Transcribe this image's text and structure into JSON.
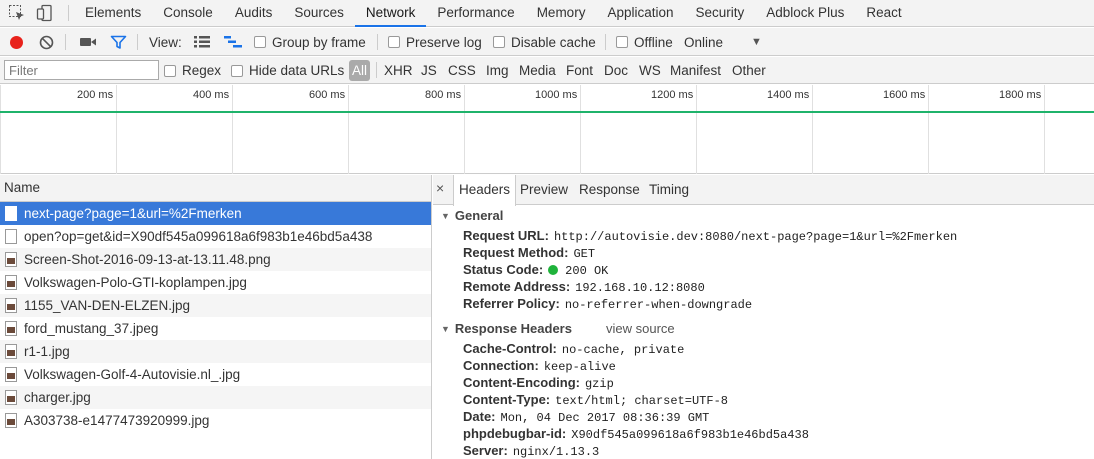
{
  "tabbar": {
    "tabs": [
      {
        "label": "Elements"
      },
      {
        "label": "Console"
      },
      {
        "label": "Audits"
      },
      {
        "label": "Sources"
      },
      {
        "label": "Network"
      },
      {
        "label": "Performance"
      },
      {
        "label": "Memory"
      },
      {
        "label": "Application"
      },
      {
        "label": "Security"
      },
      {
        "label": "Adblock Plus"
      },
      {
        "label": "React"
      }
    ],
    "active_tab": "Network"
  },
  "toolbar": {
    "view_label": "View:",
    "group_by_frame": "Group by frame",
    "preserve_log": "Preserve log",
    "disable_cache": "Disable cache",
    "offline": "Offline",
    "throttle_value": "Online",
    "dropdown_arrow": "▼"
  },
  "filter": {
    "placeholder": "Filter",
    "regex": "Regex",
    "hide_data_urls": "Hide data URLs",
    "types": [
      "All",
      "XHR",
      "JS",
      "CSS",
      "Img",
      "Media",
      "Font",
      "Doc",
      "WS",
      "Manifest",
      "Other"
    ],
    "active_type": "All"
  },
  "timeline": {
    "ticks": [
      "200 ms",
      "400 ms",
      "600 ms",
      "800 ms",
      "1000 ms",
      "1200 ms",
      "1400 ms",
      "1600 ms",
      "1800 ms"
    ]
  },
  "list": {
    "header": "Name",
    "rows": [
      {
        "name": "next-page?page=1&url=%2Fmerken",
        "icon": "doc",
        "selected": true
      },
      {
        "name": "open?op=get&id=X90df545a099618a6f983b1e46bd5a438",
        "icon": "doc"
      },
      {
        "name": "Screen-Shot-2016-09-13-at-13.11.48.png",
        "icon": "image"
      },
      {
        "name": "Volkswagen-Polo-GTI-koplampen.jpg",
        "icon": "image"
      },
      {
        "name": "1155_VAN-DEN-ELZEN.jpg",
        "icon": "image"
      },
      {
        "name": "ford_mustang_37.jpeg",
        "icon": "image"
      },
      {
        "name": "r1-1.jpg",
        "icon": "image"
      },
      {
        "name": "Volkswagen-Golf-4-Autovisie.nl_.jpg",
        "icon": "image"
      },
      {
        "name": "charger.jpg",
        "icon": "image"
      },
      {
        "name": "A303738-e1477473920999.jpg",
        "icon": "image"
      }
    ]
  },
  "details": {
    "close": "×",
    "tabs": [
      "Headers",
      "Preview",
      "Response",
      "Timing"
    ],
    "active_tab": "Headers",
    "general": {
      "title": "General",
      "items": [
        {
          "key": "Request URL:",
          "value": "http://autovisie.dev:8080/next-page?page=1&url=%2Fmerken"
        },
        {
          "key": "Request Method:",
          "value": "GET"
        },
        {
          "key": "Status Code:",
          "value": "200 OK"
        },
        {
          "key": "Remote Address:",
          "value": "192.168.10.12:8080"
        },
        {
          "key": "Referrer Policy:",
          "value": "no-referrer-when-downgrade"
        }
      ]
    },
    "response_headers": {
      "title": "Response Headers",
      "view_source": "view source",
      "items": [
        {
          "key": "Cache-Control:",
          "value": "no-cache, private"
        },
        {
          "key": "Connection:",
          "value": "keep-alive"
        },
        {
          "key": "Content-Encoding:",
          "value": "gzip"
        },
        {
          "key": "Content-Type:",
          "value": "text/html; charset=UTF-8"
        },
        {
          "key": "Date:",
          "value": "Mon, 04 Dec 2017 08:36:39 GMT"
        },
        {
          "key": "phpdebugbar-id:",
          "value": "X90df545a099618a6f983b1e46bd5a438"
        },
        {
          "key": "Server:",
          "value": "nginx/1.13.3"
        }
      ]
    }
  },
  "colors": {
    "accent": "#1a73e8",
    "selected_row": "#3879d9",
    "record": "#e8221b",
    "status_ok": "#1fb33b",
    "timeline_line": "#1fb36b"
  }
}
